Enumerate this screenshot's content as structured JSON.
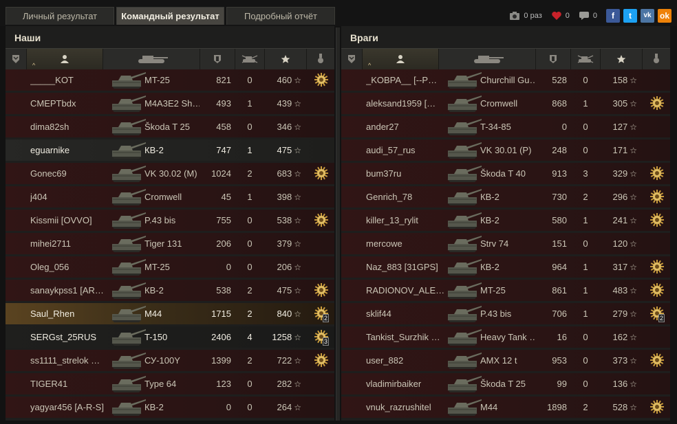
{
  "tabs": [
    {
      "label": "Личный результат",
      "active": false
    },
    {
      "label": "Командный результат",
      "active": true
    },
    {
      "label": "Подробный отчёт",
      "active": false
    }
  ],
  "share": {
    "views_count": "0 раз",
    "likes_count": "0",
    "comments_count": "0"
  },
  "teams": {
    "allies": {
      "title": "Наши",
      "players": [
        {
          "name": "_____KOT",
          "tank": "MT-25",
          "damage": "821",
          "kills": "0",
          "xp": "460",
          "medal": true,
          "medal_count": ""
        },
        {
          "name": "CMEPTbdx",
          "tank": "M4A3E2 Sh…",
          "damage": "493",
          "kills": "1",
          "xp": "439",
          "medal": false,
          "medal_count": ""
        },
        {
          "name": "dima82sh",
          "tank": "Škoda T 25",
          "damage": "458",
          "kills": "0",
          "xp": "346",
          "medal": false,
          "medal_count": ""
        },
        {
          "name": "eguarnike",
          "tank": "КВ-2",
          "damage": "747",
          "kills": "1",
          "xp": "475",
          "medal": false,
          "medal_count": "",
          "highlight": "self"
        },
        {
          "name": "Gonec69",
          "tank": "VK 30.02 (M)",
          "damage": "1024",
          "kills": "2",
          "xp": "683",
          "medal": true,
          "medal_count": ""
        },
        {
          "name": "j404",
          "tank": "Cromwell",
          "damage": "45",
          "kills": "1",
          "xp": "398",
          "medal": false,
          "medal_count": ""
        },
        {
          "name": "Kissmii [OVVO]",
          "tank": "P.43 bis",
          "damage": "755",
          "kills": "0",
          "xp": "538",
          "medal": true,
          "medal_count": ""
        },
        {
          "name": "mihei2711",
          "tank": "Tiger 131",
          "damage": "206",
          "kills": "0",
          "xp": "379",
          "medal": false,
          "medal_count": ""
        },
        {
          "name": "Oleg_056",
          "tank": "MT-25",
          "damage": "0",
          "kills": "0",
          "xp": "206",
          "medal": false,
          "medal_count": ""
        },
        {
          "name": "sanaykpss1 [AR…",
          "tank": "КВ-2",
          "damage": "538",
          "kills": "2",
          "xp": "475",
          "medal": true,
          "medal_count": ""
        },
        {
          "name": "Saul_Rhen",
          "tank": "M44",
          "damage": "1715",
          "kills": "2",
          "xp": "840",
          "medal": true,
          "medal_count": "2",
          "highlight": "platoon"
        },
        {
          "name": "SERGst_25RUS",
          "tank": "T-150",
          "damage": "2406",
          "kills": "4",
          "xp": "1258",
          "medal": true,
          "medal_count": "3",
          "highlight": "dark"
        },
        {
          "name": "ss1111_strelok …",
          "tank": "СУ-100Y",
          "damage": "1399",
          "kills": "2",
          "xp": "722",
          "medal": true,
          "medal_count": ""
        },
        {
          "name": "TIGER41",
          "tank": "Type 64",
          "damage": "123",
          "kills": "0",
          "xp": "282",
          "medal": false,
          "medal_count": ""
        },
        {
          "name": "yagyar456 [A-R-S]",
          "tank": "КВ-2",
          "damage": "0",
          "kills": "0",
          "xp": "264",
          "medal": false,
          "medal_count": ""
        }
      ]
    },
    "enemies": {
      "title": "Враги",
      "players": [
        {
          "name": "_KOBPA__ [--P…",
          "tank": "Churchill Gu…",
          "damage": "528",
          "kills": "0",
          "xp": "158",
          "medal": false,
          "medal_count": ""
        },
        {
          "name": "aleksand1959 […",
          "tank": "Cromwell",
          "damage": "868",
          "kills": "1",
          "xp": "305",
          "medal": true,
          "medal_count": ""
        },
        {
          "name": "ander27",
          "tank": "T-34-85",
          "damage": "0",
          "kills": "0",
          "xp": "127",
          "medal": false,
          "medal_count": ""
        },
        {
          "name": "audi_57_rus",
          "tank": "VK 30.01 (P)",
          "damage": "248",
          "kills": "0",
          "xp": "171",
          "medal": false,
          "medal_count": ""
        },
        {
          "name": "bum37ru",
          "tank": "Škoda T 40",
          "damage": "913",
          "kills": "3",
          "xp": "329",
          "medal": true,
          "medal_count": ""
        },
        {
          "name": "Genrich_78",
          "tank": "КВ-2",
          "damage": "730",
          "kills": "2",
          "xp": "296",
          "medal": true,
          "medal_count": ""
        },
        {
          "name": "killer_13_rylit",
          "tank": "КВ-2",
          "damage": "580",
          "kills": "1",
          "xp": "241",
          "medal": true,
          "medal_count": ""
        },
        {
          "name": "mercowe",
          "tank": "Strv 74",
          "damage": "151",
          "kills": "0",
          "xp": "120",
          "medal": false,
          "medal_count": ""
        },
        {
          "name": "Naz_883 [31GPS]",
          "tank": "КВ-2",
          "damage": "964",
          "kills": "1",
          "xp": "317",
          "medal": true,
          "medal_count": ""
        },
        {
          "name": "RADIONOV_ALE…",
          "tank": "MT-25",
          "damage": "861",
          "kills": "1",
          "xp": "483",
          "medal": true,
          "medal_count": ""
        },
        {
          "name": "sklif44",
          "tank": "P.43 bis",
          "damage": "706",
          "kills": "1",
          "xp": "279",
          "medal": true,
          "medal_count": "2"
        },
        {
          "name": "Tankist_Surzhik …",
          "tank": "Heavy Tank …",
          "damage": "16",
          "kills": "0",
          "xp": "162",
          "medal": false,
          "medal_count": ""
        },
        {
          "name": "user_882",
          "tank": "AMX 12 t",
          "damage": "953",
          "kills": "0",
          "xp": "373",
          "medal": true,
          "medal_count": ""
        },
        {
          "name": "vladimirbaiker",
          "tank": "Škoda T 25",
          "damage": "99",
          "kills": "0",
          "xp": "136",
          "medal": false,
          "medal_count": ""
        },
        {
          "name": "vnuk_razrushitel",
          "tank": "M44",
          "damage": "1898",
          "kills": "2",
          "xp": "528",
          "medal": true,
          "medal_count": ""
        }
      ]
    }
  },
  "icons": {
    "camera": "camera-icon",
    "heart": "heart-icon",
    "comment": "comment-icon",
    "facebook": "facebook-icon",
    "twitter": "twitter-icon",
    "vk": "vk-icon",
    "odnoklassniki": "odnoklassniki-icon",
    "social_labels": {
      "fb": "f",
      "tw": "t",
      "vk": "vk",
      "ok": "ok"
    }
  }
}
